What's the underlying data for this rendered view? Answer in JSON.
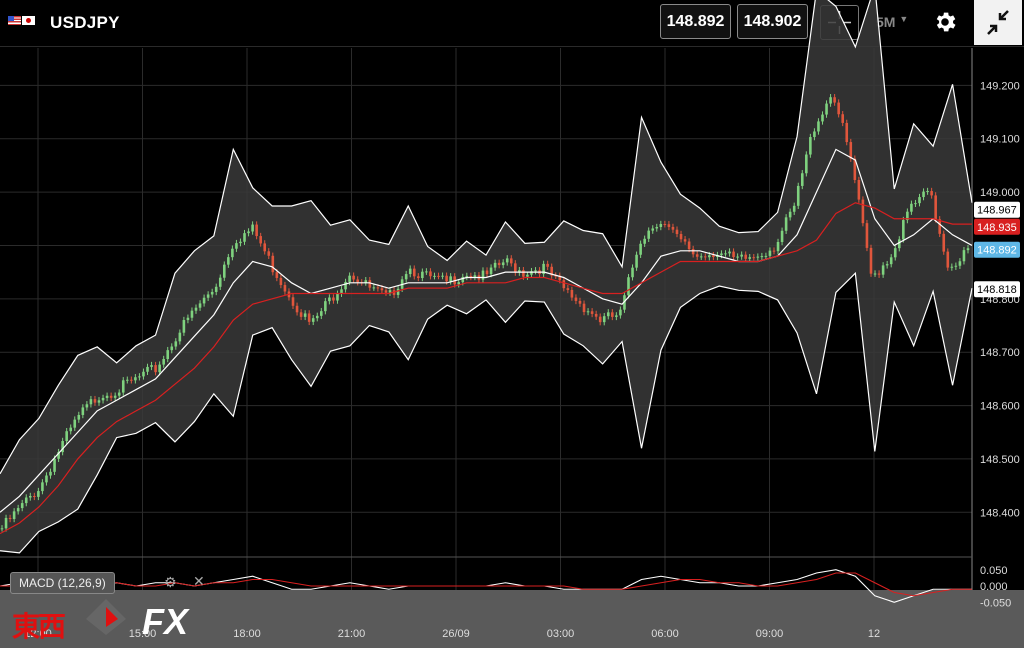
{
  "header": {
    "symbol": "USDJPY",
    "bid": "148.892",
    "ask": "148.902",
    "timeframe": "5M",
    "icons": [
      "flag-us-icon",
      "flag-jp-icon",
      "crosshair-icon",
      "gear-icon",
      "collapse-icon"
    ]
  },
  "indicator": {
    "label": "MACD (12,26,9)"
  },
  "watermark": {
    "kanji": "東西",
    "fx": "FX"
  },
  "colors": {
    "up": "#7fd27f",
    "down": "#e0563c",
    "ma": "#d82020",
    "band": "#ffffff",
    "last": "#5fb7e6",
    "bg": "#000000"
  },
  "chart_data": [
    {
      "type": "line",
      "title": "USDJPY",
      "x_ticks": [
        "12:00",
        "15:00",
        "18:00",
        "21:00",
        "26/09",
        "03:00",
        "06:00",
        "09:00",
        "12"
      ],
      "y_ticks": [
        "148.400",
        "148.500",
        "148.600",
        "148.700",
        "148.800",
        "148.900",
        "149.000",
        "149.100",
        "149.200"
      ],
      "ylim": [
        148.32,
        149.27
      ],
      "price_labels": [
        "148.967",
        "148.935",
        "148.892",
        "148.818"
      ],
      "grid": true,
      "series": [
        {
          "values": [
            148.37,
            148.41,
            148.45,
            148.52,
            148.58,
            148.62,
            148.63,
            148.65,
            148.67,
            148.73,
            148.78,
            148.82,
            148.91,
            148.93,
            148.86,
            148.8,
            148.75,
            148.8,
            148.85,
            148.82,
            148.8,
            148.86,
            148.84,
            148.83,
            148.85,
            148.84,
            148.87,
            148.85,
            148.86,
            148.82,
            148.79,
            148.76,
            148.77,
            148.91,
            148.95,
            148.91,
            148.88,
            148.89,
            148.87,
            148.88,
            148.9,
            148.97,
            149.12,
            149.19,
            149.05,
            148.84,
            148.88,
            148.97,
            149.0,
            148.86,
            148.89
          ]
        },
        {
          "values": [
            148.4,
            148.43,
            148.47,
            148.51,
            148.55,
            148.59,
            148.61,
            148.63,
            148.65,
            148.69,
            148.73,
            148.77,
            148.83,
            148.87,
            148.86,
            148.83,
            148.81,
            148.82,
            148.83,
            148.83,
            148.82,
            148.83,
            148.83,
            148.83,
            148.84,
            148.84,
            148.85,
            148.85,
            148.85,
            148.84,
            148.82,
            148.8,
            148.79,
            148.83,
            148.88,
            148.89,
            148.89,
            148.88,
            148.87,
            148.87,
            148.88,
            148.92,
            149.0,
            149.08,
            149.06,
            148.95,
            148.9,
            148.92,
            148.95,
            148.92,
            148.9
          ]
        },
        {
          "values": [
            148.36,
            148.38,
            148.41,
            148.45,
            148.5,
            148.54,
            148.57,
            148.59,
            148.61,
            148.64,
            148.67,
            148.71,
            148.76,
            148.79,
            148.8,
            148.81,
            148.81,
            148.81,
            148.81,
            148.81,
            148.81,
            148.82,
            148.82,
            148.82,
            148.83,
            148.83,
            148.83,
            148.84,
            148.84,
            148.83,
            148.82,
            148.81,
            148.81,
            148.83,
            148.85,
            148.87,
            148.87,
            148.87,
            148.87,
            148.87,
            148.88,
            148.89,
            148.91,
            148.96,
            148.98,
            148.97,
            148.95,
            148.95,
            148.95,
            148.94,
            148.94
          ]
        }
      ]
    },
    {
      "type": "line",
      "title": "MACD (12,26,9)",
      "y_ticks": [
        "0.050",
        "0.000",
        "-0.050"
      ],
      "ylim": [
        -0.08,
        0.08
      ],
      "series": [
        {
          "values": [
            0.0,
            0.01,
            0.0,
            0.01,
            0.01,
            0.0,
            0.01,
            0.0,
            0.01,
            0.01,
            0.0,
            0.01,
            0.02,
            0.03,
            0.01,
            -0.01,
            -0.01,
            0.0,
            0.01,
            0.0,
            -0.01,
            0.0,
            0.0,
            0.0,
            0.0,
            0.0,
            0.01,
            0.0,
            0.0,
            -0.01,
            -0.01,
            -0.01,
            -0.01,
            0.02,
            0.03,
            0.02,
            0.01,
            0.01,
            0.0,
            0.0,
            0.01,
            0.02,
            0.04,
            0.05,
            0.03,
            -0.03,
            -0.05,
            -0.03,
            -0.01,
            -0.01,
            -0.01
          ]
        },
        {
          "values": [
            0.0,
            0.0,
            0.0,
            0.0,
            0.01,
            0.01,
            0.01,
            0.0,
            0.0,
            0.01,
            0.0,
            0.01,
            0.01,
            0.02,
            0.02,
            0.01,
            0.0,
            0.0,
            0.0,
            0.0,
            0.0,
            0.0,
            0.0,
            0.0,
            0.0,
            0.0,
            0.0,
            0.0,
            0.0,
            0.0,
            -0.01,
            -0.01,
            -0.01,
            0.0,
            0.01,
            0.02,
            0.02,
            0.01,
            0.01,
            0.0,
            0.0,
            0.01,
            0.02,
            0.04,
            0.04,
            0.01,
            -0.02,
            -0.03,
            -0.02,
            -0.01,
            -0.01
          ]
        }
      ]
    }
  ]
}
